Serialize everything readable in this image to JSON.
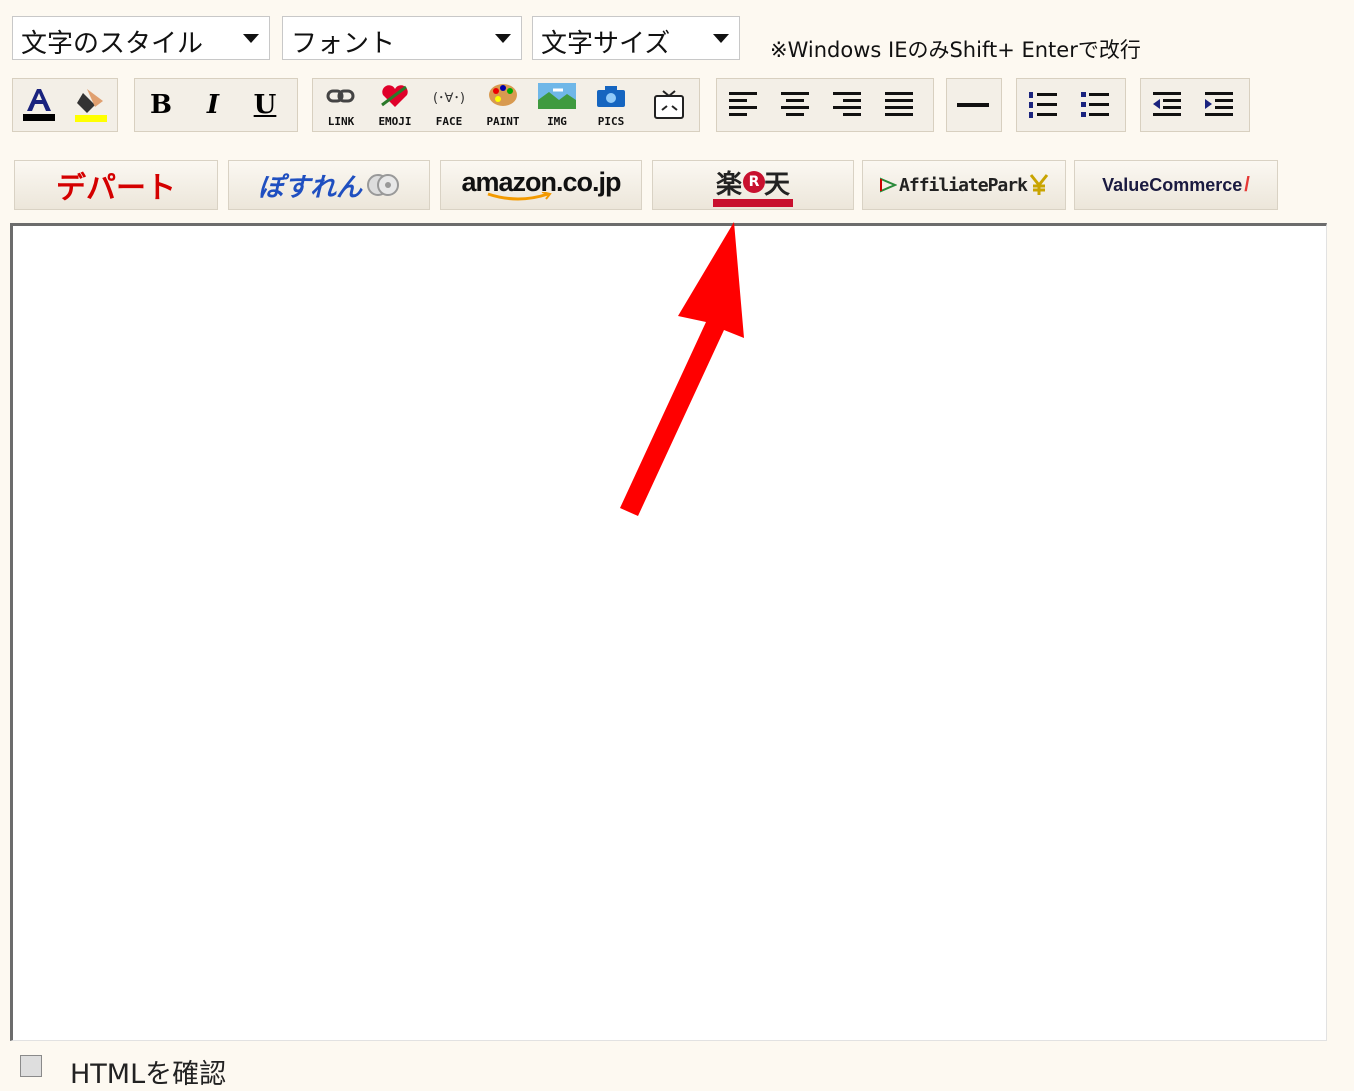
{
  "toolbar_selects": {
    "style": "文字のスタイル",
    "font": "フォント",
    "size": "文字サイズ"
  },
  "note": "※Windows IEのみShift+ Enterで改行",
  "format_buttons": {
    "bold": "B",
    "italic": "I",
    "underline": "U",
    "link": "LINK",
    "emoji": "EMOJI",
    "face": "FACE",
    "face_glyph": "(･∀･)",
    "paint": "PAINT",
    "img": "IMG",
    "pics": "PICS"
  },
  "affiliates": {
    "depart": "デパート",
    "pomparade": "ぽすれん",
    "amazon": "amazon.co.jp",
    "rakuten": "楽天",
    "rakuten_r": "R",
    "affiliatepark": "AffiliatePark",
    "valuecommerce": "ValueCommerce"
  },
  "checkbox": {
    "label": "HTMLを確認",
    "checked": false
  },
  "colors": {
    "arrow": "#ff0000",
    "background": "#fdf9f1"
  }
}
